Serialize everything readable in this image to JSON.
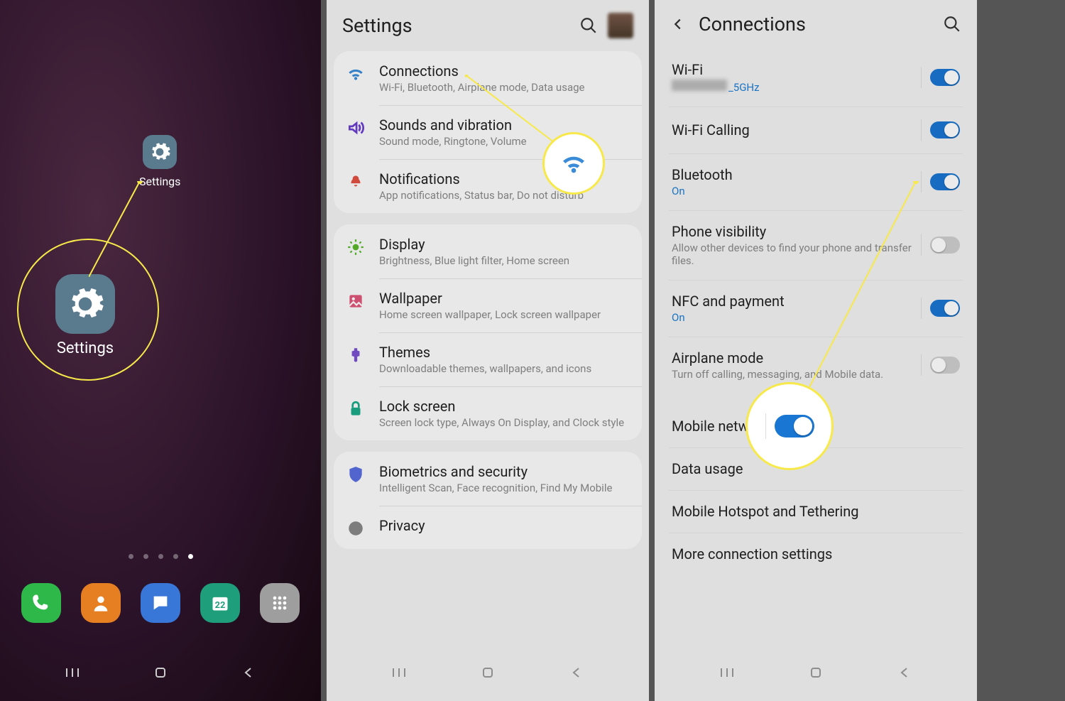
{
  "panel1": {
    "app_label": "Settings",
    "dots": 5
  },
  "panel2": {
    "title": "Settings",
    "groups": [
      {
        "rows": [
          {
            "icon": "wifi",
            "color": "#3a8cd8",
            "title": "Connections",
            "sub": "Wi-Fi, Bluetooth, Airplane mode, Data usage"
          },
          {
            "icon": "sound",
            "color": "#6a3fcf",
            "title": "Sounds and vibration",
            "sub": "Sound mode, Ringtone, Volume"
          },
          {
            "icon": "notif",
            "color": "#e25040",
            "title": "Notifications",
            "sub": "App notifications, Status bar, Do not disturb"
          }
        ]
      },
      {
        "rows": [
          {
            "icon": "display",
            "color": "#5ab82a",
            "title": "Display",
            "sub": "Brightness, Blue light filter, Home screen"
          },
          {
            "icon": "wallpaper",
            "color": "#e0577a",
            "title": "Wallpaper",
            "sub": "Home screen wallpaper, Lock screen wallpaper"
          },
          {
            "icon": "themes",
            "color": "#7a4fd0",
            "title": "Themes",
            "sub": "Downloadable themes, wallpapers, and icons"
          },
          {
            "icon": "lock",
            "color": "#1caa88",
            "title": "Lock screen",
            "sub": "Screen lock type, Always On Display, and Clock style"
          }
        ]
      },
      {
        "rows": [
          {
            "icon": "security",
            "color": "#5a6de0",
            "title": "Biometrics and security",
            "sub": "Intelligent Scan, Face recognition, Find My Mobile"
          },
          {
            "icon": "privacy",
            "color": "#888",
            "title": "Privacy",
            "sub": ""
          }
        ]
      }
    ]
  },
  "panel3": {
    "title": "Connections",
    "wifi_suffix": "_5GHz",
    "items": [
      {
        "title": "Wi-Fi",
        "sub": "NETWORK_5GHz",
        "on": true,
        "toggle": true
      },
      {
        "title": "Wi-Fi Calling",
        "on": true,
        "toggle": true
      },
      {
        "title": "Bluetooth",
        "sub": "On",
        "on": true,
        "toggle": true
      },
      {
        "title": "Phone visibility",
        "sub": "Allow other devices to find your phone and transfer files.",
        "subgray": true,
        "on": false,
        "toggle": true
      },
      {
        "title": "NFC and payment",
        "sub": "On",
        "on": true,
        "toggle": true
      },
      {
        "title": "Airplane mode",
        "sub": "Turn off calling, messaging, and Mobile data.",
        "subgray": true,
        "on": false,
        "toggle": true
      },
      {
        "title": "Mobile networks",
        "toggle": false
      },
      {
        "title": "Data usage",
        "toggle": false
      },
      {
        "title": "Mobile Hotspot and Tethering",
        "toggle": false
      },
      {
        "title": "More connection settings",
        "toggle": false
      }
    ]
  }
}
